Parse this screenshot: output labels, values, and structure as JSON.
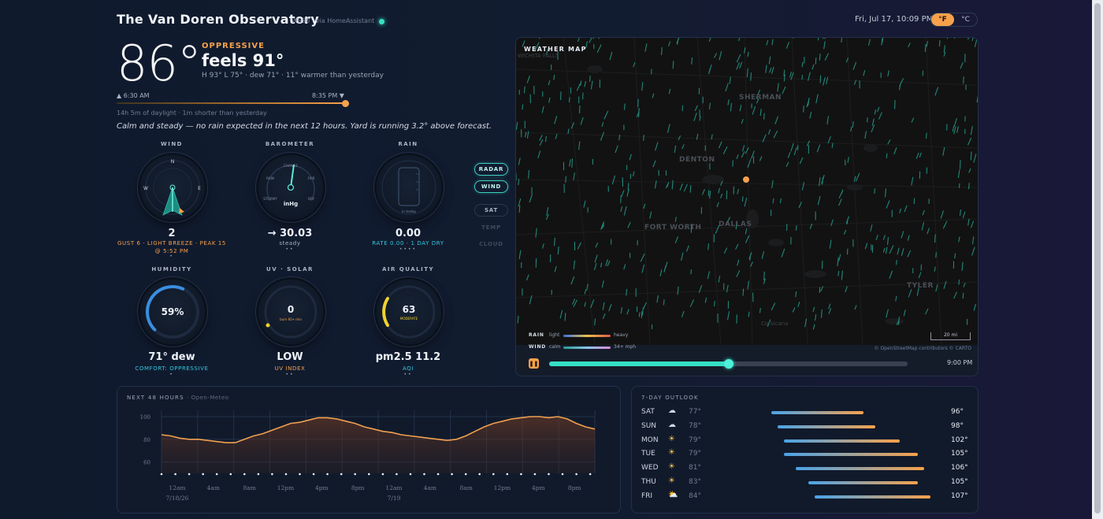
{
  "header": {
    "title": "The Van Doren Observatory",
    "source": "WS90 · via HomeAssistant",
    "datetime": "Fri, Jul 17, 10:09 PM",
    "unit_f": "°F",
    "unit_c": "°C",
    "active_unit": "F"
  },
  "current": {
    "temp": "86°",
    "condition": "OPPRESSIVE",
    "feels": "feels 91°",
    "hilo": "H 93° L 75° · dew 71° · 11° warmer than yesterday",
    "sunrise": "▲ 6:30 AM",
    "sunset": "8:35 PM ▼",
    "daylight": "14h 5m of daylight · 1m shorter than yesterday",
    "summary": "Calm and steady — no rain expected in the next 12 hours. Yard is running 3.2° above forecast."
  },
  "gauges": {
    "wind": {
      "label": "WIND",
      "value": "2",
      "sub": "GUST 6 · LIGHT BREEZE · PEAK 15",
      "sub2": "@ 5:52 PM",
      "compass": {
        "n": "N",
        "e": "E",
        "w": "W"
      },
      "direction_deg": 155
    },
    "barometer": {
      "label": "BAROMETER",
      "value": "→ 30.03",
      "sub": "steady",
      "unit": "inHg",
      "ticks": {
        "change": "CHANGE",
        "rain": "RAIN",
        "fair": "FAIR",
        "stormy": "STORMY",
        "dry": "DRY"
      }
    },
    "rain": {
      "label": "RAIN",
      "value": "0.00",
      "sub": "RATE 0.00 · 1 DAY DRY",
      "inner": "in today"
    },
    "humidity": {
      "label": "HUMIDITY",
      "value": "59%",
      "big": "71° dew",
      "sub": "COMFORT: OPPRESSIVE",
      "percent": 59
    },
    "uv": {
      "label": "UV · SOLAR",
      "value": "0",
      "inner": "burn 60+ min",
      "big": "LOW",
      "sub": "UV INDEX"
    },
    "aqi": {
      "label": "AIR QUALITY",
      "value": "63",
      "inner": "MODERATE",
      "big": "pm2.5 11.2",
      "sub": "AQI"
    }
  },
  "map_layers": [
    "RADAR",
    "WIND",
    "SAT",
    "TEMP",
    "CLOUD"
  ],
  "map": {
    "title": "WEATHER MAP",
    "cities": [
      "SHERMAN",
      "DENTON",
      "FORT WORTH",
      "DALLAS",
      "TYLER",
      "Corsicana",
      "WICHITA FALLS"
    ],
    "scale": "20 mi",
    "attribution": "© OpenStreetMap contributors © CARTO",
    "legend_rain": "RAIN",
    "legend_rain_light": "light",
    "legend_rain_heavy": "heavy",
    "legend_wind": "WIND",
    "legend_wind_calm": "calm",
    "legend_wind_max": "34+ mph",
    "time": "9:00 PM",
    "timeline_progress": 0.5
  },
  "forecast48": {
    "title": "NEXT 48 HOURS",
    "source": "· Open-Meteo"
  },
  "chart_data": {
    "type": "area",
    "title": "NEXT 48 HOURS",
    "ylim": [
      50,
      100
    ],
    "yticks": [
      60,
      80,
      100
    ],
    "xtick_labels": [
      "12am",
      "4am",
      "8am",
      "12pm",
      "4pm",
      "8pm",
      "12am",
      "4am",
      "8am",
      "12pm",
      "4pm",
      "8pm"
    ],
    "date_labels": [
      "7/18/26",
      "7/19"
    ],
    "series": [
      {
        "values": [
          84,
          83,
          81,
          80,
          80,
          79,
          78,
          77,
          77,
          80,
          83,
          85,
          88,
          91,
          94,
          95,
          97,
          99,
          99,
          98,
          96,
          94,
          91,
          89,
          87,
          86,
          84,
          83,
          82,
          81,
          80,
          79,
          80,
          83,
          87,
          91,
          94,
          96,
          98,
          99,
          100,
          100,
          99,
          100,
          98,
          94,
          91,
          89
        ]
      }
    ]
  },
  "outlook": {
    "title": "7-DAY OUTLOOK",
    "days": [
      {
        "day": "SAT",
        "icon": "☁",
        "lo": "77°",
        "hi": "96°",
        "lo_v": 77,
        "hi_v": 96
      },
      {
        "day": "SUN",
        "icon": "☁",
        "lo": "78°",
        "hi": "98°",
        "lo_v": 78,
        "hi_v": 98
      },
      {
        "day": "MON",
        "icon": "☀",
        "lo": "79°",
        "hi": "102°",
        "lo_v": 79,
        "hi_v": 102
      },
      {
        "day": "TUE",
        "icon": "☀",
        "lo": "79°",
        "hi": "105°",
        "lo_v": 79,
        "hi_v": 105
      },
      {
        "day": "WED",
        "icon": "☀",
        "lo": "81°",
        "hi": "106°",
        "lo_v": 81,
        "hi_v": 106
      },
      {
        "day": "THU",
        "icon": "☀",
        "lo": "83°",
        "hi": "105°",
        "lo_v": 83,
        "hi_v": 105
      },
      {
        "day": "FRI",
        "icon": "⛅",
        "lo": "84°",
        "hi": "107°",
        "lo_v": 84,
        "hi_v": 107
      }
    ]
  },
  "colors": {
    "accent": "#f7a14b",
    "teal": "#35e0c5",
    "bg": "#0f1a2d"
  }
}
